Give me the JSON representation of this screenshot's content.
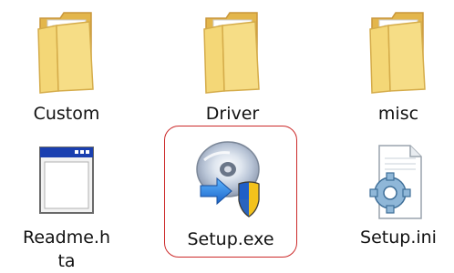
{
  "items": [
    {
      "label": "Custom",
      "type": "folder",
      "icon": "folder-icon"
    },
    {
      "label": "Driver",
      "type": "folder",
      "icon": "folder-icon"
    },
    {
      "label": "misc",
      "type": "folder",
      "icon": "folder-icon"
    },
    {
      "label": "Readme.h\nta",
      "type": "hta-file",
      "icon": "application-window-icon"
    },
    {
      "label": "Setup.exe",
      "type": "executable",
      "icon": "setup-disc-shield-icon",
      "highlighted": true
    },
    {
      "label": "Setup.ini",
      "type": "config-file",
      "icon": "settings-file-icon"
    }
  ],
  "colors": {
    "highlight_border": "#cc2a2a",
    "folder": "#f2d46e",
    "window_titlebar": "#1a3fb0",
    "shield_blue": "#1f5fc7",
    "shield_yellow": "#f3c21c"
  }
}
